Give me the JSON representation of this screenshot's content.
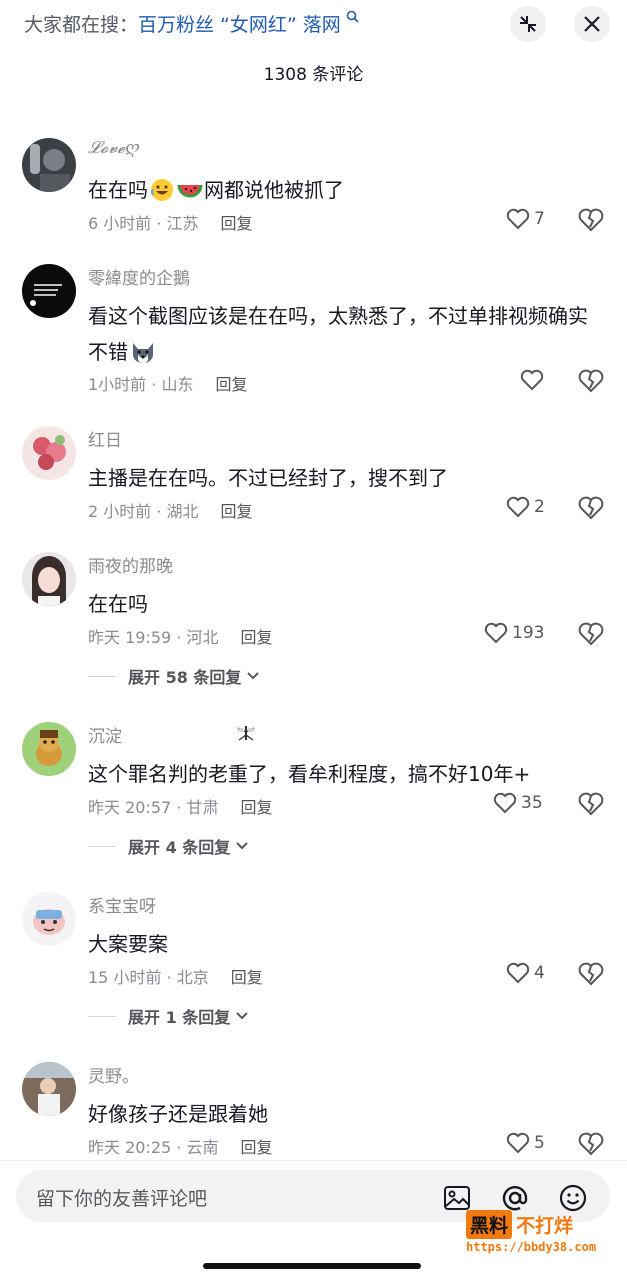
{
  "header": {
    "search_prefix": "大家都在搜：",
    "search_query": "百万粉丝 “女网红” 落网",
    "collapse_icon": "collapse-arrows-icon",
    "close_icon": "close-icon",
    "comment_count": "1308 条评论"
  },
  "comments": [
    {
      "username": "𝓛𝓸𝓿𝓮ღ",
      "text_before": "在在吗",
      "emojis": [
        "rolling-laugh-emoji",
        "watermelon-emoji"
      ],
      "text_after": "网都说他被抓了",
      "time_location": "6 小时前 · 江苏",
      "reply": "回复",
      "likes": "7"
    },
    {
      "username": "零緯度的企鵝",
      "text_before": "看这个截图应该是在在吗，太熟悉了，不过单排视频确实不错",
      "emojis": [
        "husky-emoji"
      ],
      "text_after": "",
      "time_location": "1小时前 · 山东",
      "reply": "回复",
      "likes": ""
    },
    {
      "username": "红日",
      "text_before": "主播是在在吗。不过已经封了，搜不到了",
      "emojis": [],
      "text_after": "",
      "time_location": "2 小时前 · 湖北",
      "reply": "回复",
      "likes": "2"
    },
    {
      "username": "雨夜的那晚",
      "text_before": "在在吗",
      "emojis": [],
      "text_after": "",
      "time_location": "昨天 19:59 · 河北",
      "reply": "回复",
      "likes": "193",
      "expand": "展开 58 条回复"
    },
    {
      "username": "沉淀",
      "text_before": "这个罪名判的老重了，看牟利程度，搞不好10年+",
      "emojis": [],
      "text_after": "",
      "time_location": "昨天 20:57 · 甘肃",
      "reply": "回复",
      "likes": "35",
      "expand": "展开 4 条回复"
    },
    {
      "username": "系宝宝呀",
      "text_before": "大案要案",
      "emojis": [],
      "text_after": "",
      "time_location": "15 小时前 · 北京",
      "reply": "回复",
      "likes": "4",
      "expand": "展开 1 条回复"
    },
    {
      "username": "灵野。",
      "text_before": "好像孩子还是跟着她",
      "emojis": [],
      "text_after": "",
      "time_location": "昨天 20:25 · 云南",
      "reply": "回复",
      "likes": "5"
    }
  ],
  "composer": {
    "placeholder": "留下你的友善评论吧",
    "icons": [
      "image-icon",
      "at-icon",
      "emoji-icon"
    ]
  },
  "watermark": {
    "brand_box": "黑料",
    "brand_text": "不打烊",
    "url": "https://bbdy38.com"
  },
  "colors": {
    "accent_link": "#1f5bb0",
    "secondary_text": "#8a8b91",
    "watermark_orange": "#f07a10"
  }
}
